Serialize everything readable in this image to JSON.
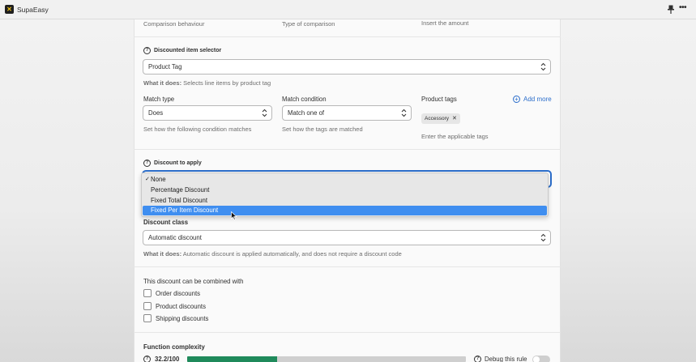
{
  "app": {
    "title": "SupaEasy"
  },
  "top_section": {
    "comparison_behaviour": "Comparison behaviour",
    "type_of_comparison": "Type of comparison",
    "insert_amount": "Insert the amount"
  },
  "item_selector": {
    "heading": "Discounted item selector",
    "selected": "Product Tag",
    "what_label": "What it does:",
    "what_text": " Selects line items by product tag",
    "match_type": {
      "label": "Match type",
      "value": "Does",
      "help": "Set how the following condition matches"
    },
    "match_condition": {
      "label": "Match condition",
      "value": "Match one of",
      "help": "Set how the tags are matched"
    },
    "product_tags": {
      "label": "Product tags",
      "add_more": "Add more",
      "tags": [
        "Accessory"
      ],
      "help": "Enter the applicable tags"
    }
  },
  "discount_to_apply": {
    "heading": "Discount to apply",
    "options": [
      "None",
      "Percentage Discount",
      "Fixed Total Discount",
      "Fixed Per Item Discount"
    ],
    "checked_option": "None",
    "highlighted_option": "Fixed Per Item Discount"
  },
  "discount_class": {
    "label": "Discount class",
    "value": "Automatic discount",
    "what_label": "What it does:",
    "what_text": " Automatic discount is applied automatically, and does not require a discount code"
  },
  "combine": {
    "heading": "This discount can be combined with",
    "options": [
      {
        "label": "Order discounts",
        "checked": false
      },
      {
        "label": "Product discounts",
        "checked": false
      },
      {
        "label": "Shipping discounts",
        "checked": false
      }
    ]
  },
  "complexity": {
    "heading": "Function complexity",
    "value_text": "32.2/100",
    "fraction": 0.322,
    "debug_label": "Debug this rule",
    "debug_enabled": false
  },
  "colors": {
    "accent": "#2c6ecb",
    "progress": "#1f8a5b",
    "highlight": "#3f8ef0"
  }
}
